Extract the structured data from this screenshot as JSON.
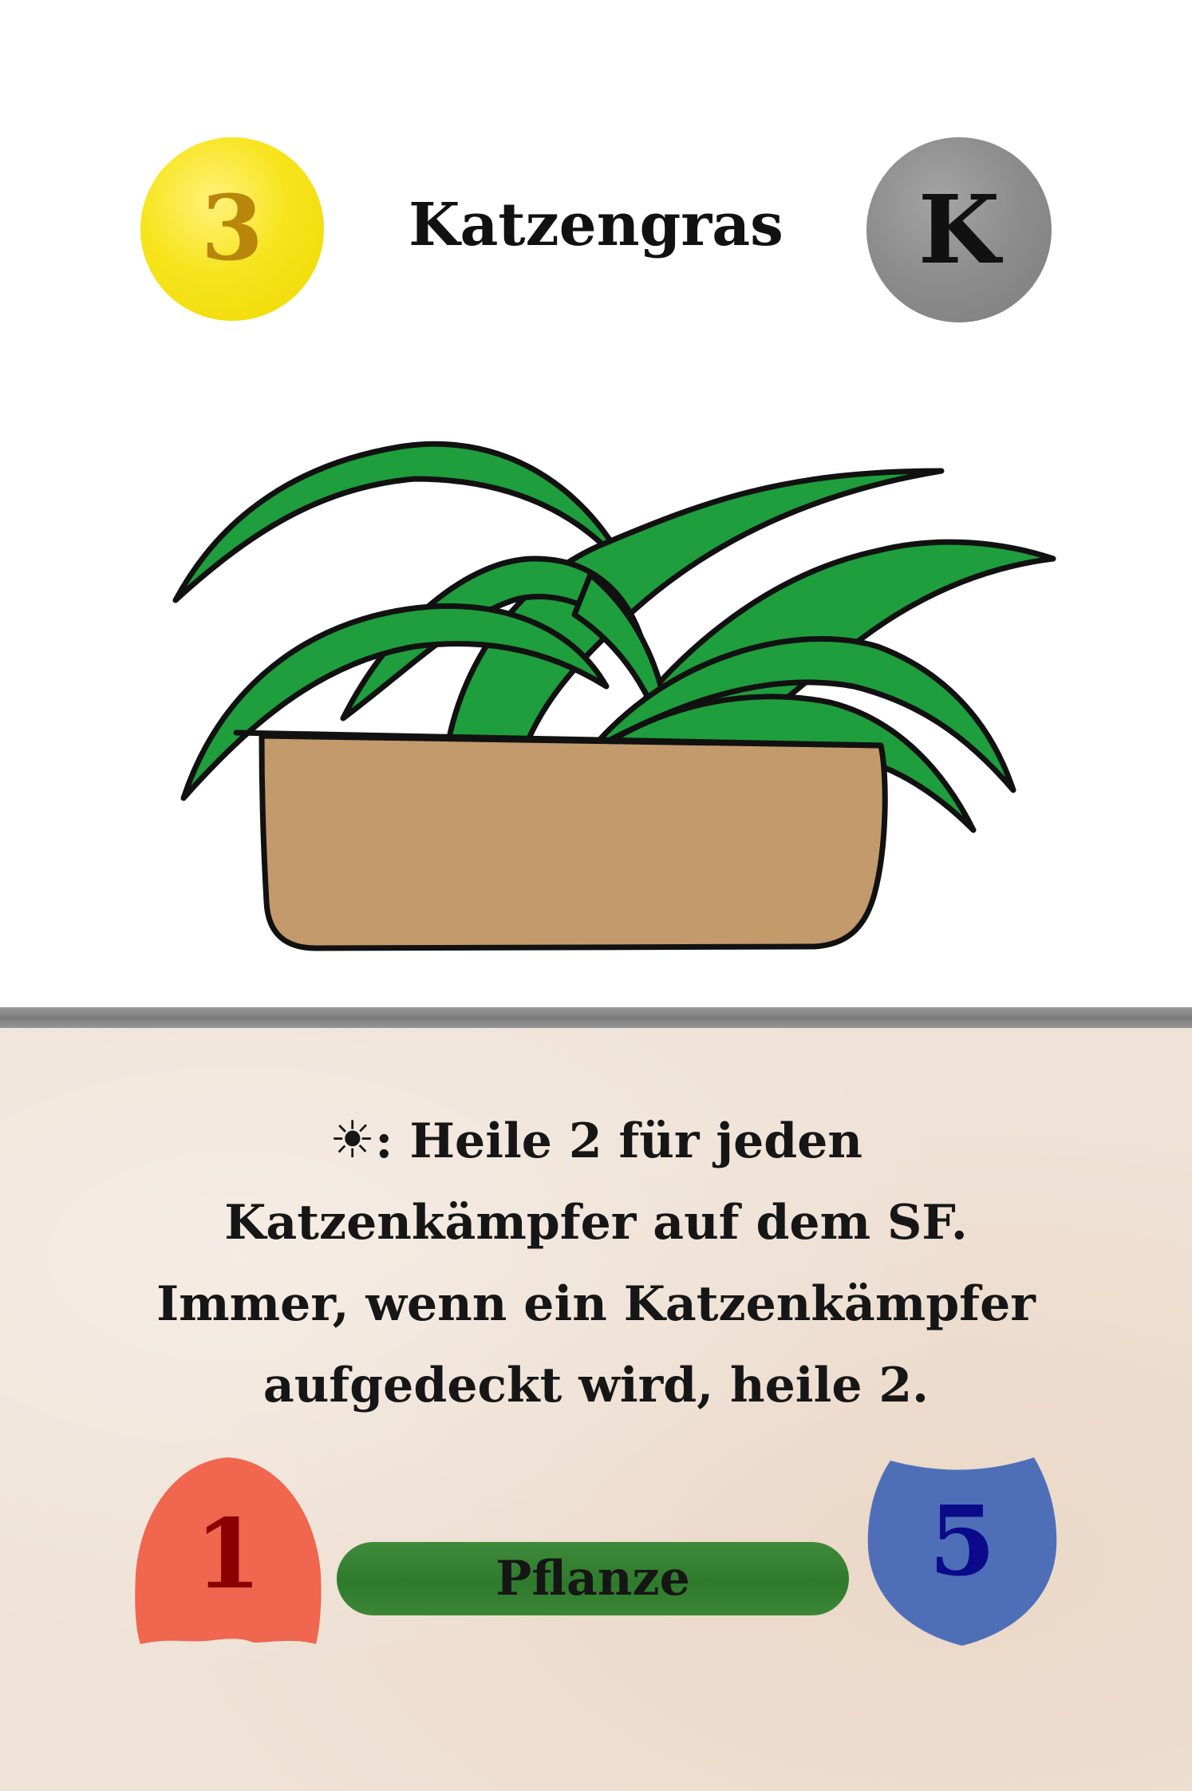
{
  "card": {
    "cost": "3",
    "title": "Katzengras",
    "rarity": "K",
    "type": "Pflanze",
    "attack": "1",
    "defense": "5",
    "ability": {
      "icon": "☀",
      "lines": [
        ": Heile 2 für jeden",
        "Katzenkämpfer auf dem SF.",
        "Immer, wenn ein Katzenkämpfer",
        "aufgedeckt wird, heile 2."
      ]
    },
    "colors": {
      "cost_coin": "#f7e41e",
      "rarity_coin": "#8c8c8c",
      "attack": "#f0664e",
      "defense": "#4e6fb8",
      "type_banner": "#2f7a2c",
      "leaf": "#1f9e3d",
      "pot": "#c29a6b",
      "panel": "#efe2d6"
    },
    "illustration": "cat-grass-plant-in-pot"
  }
}
